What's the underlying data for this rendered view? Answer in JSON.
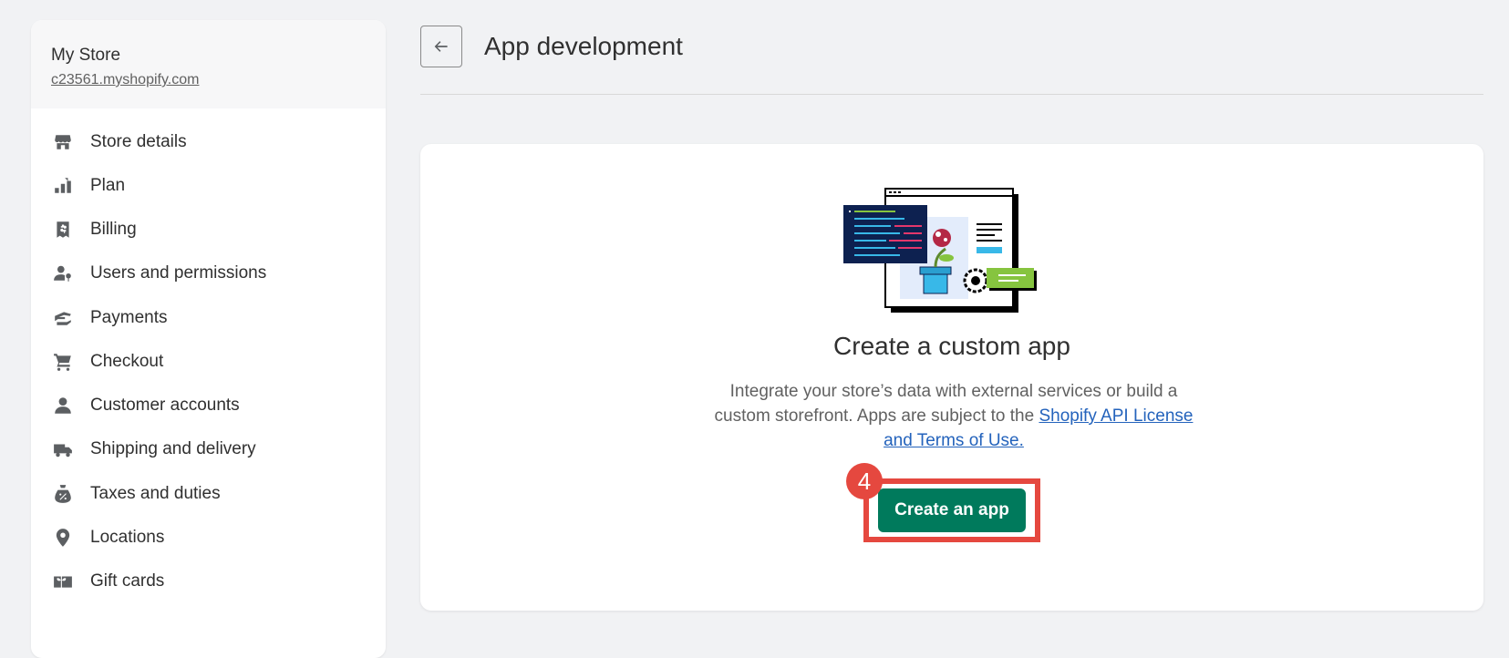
{
  "sidebar": {
    "store_name": "My Store",
    "store_url": "c23561.myshopify.com",
    "items": [
      {
        "label": "Store details",
        "icon": "store-icon"
      },
      {
        "label": "Plan",
        "icon": "plan-icon"
      },
      {
        "label": "Billing",
        "icon": "billing-icon"
      },
      {
        "label": "Users and permissions",
        "icon": "users-icon"
      },
      {
        "label": "Payments",
        "icon": "payments-icon"
      },
      {
        "label": "Checkout",
        "icon": "cart-icon"
      },
      {
        "label": "Customer accounts",
        "icon": "person-icon"
      },
      {
        "label": "Shipping and delivery",
        "icon": "truck-icon"
      },
      {
        "label": "Taxes and duties",
        "icon": "tax-icon"
      },
      {
        "label": "Locations",
        "icon": "location-pin-icon"
      },
      {
        "label": "Gift cards",
        "icon": "gift-card-icon"
      }
    ]
  },
  "header": {
    "title": "App development",
    "back_icon": "arrow-left-icon"
  },
  "card": {
    "title": "Create a custom app",
    "desc_text": "Integrate your store’s data with external services or build a custom storefront. Apps are subject to the ",
    "desc_link": "Shopify API License and Terms of Use.",
    "button_label": "Create an app",
    "step_number": "4"
  },
  "colors": {
    "primary_button": "#007a5c",
    "highlight": "#e5483f",
    "link": "#2463bc"
  }
}
